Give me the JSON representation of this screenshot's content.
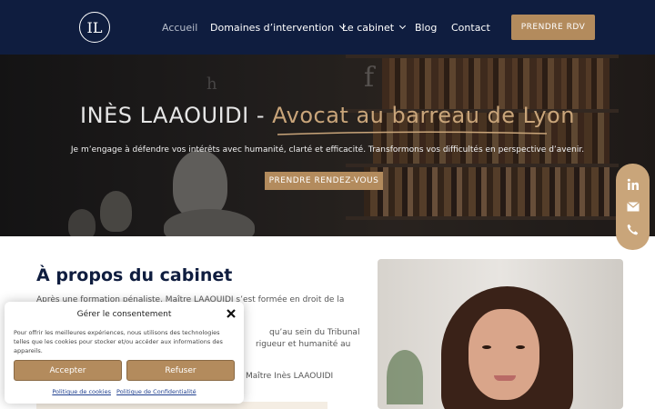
{
  "header": {
    "logo": "IL",
    "nav": {
      "home": "Accueil",
      "domaines": "Domaines d’intervention",
      "cabinet": "Le cabinet",
      "blog": "Blog",
      "contact": "Contact"
    },
    "cta": "PRENDRE RDV"
  },
  "hero": {
    "title_name": "INÈS LAAOUIDI - ",
    "title_accent": "Avocat au barreau de Lyon",
    "subtitle": "Je m’engage à défendre vos intérêts avec humanité, clarté et efficacité. Transformons vos difficultés en perspective d’avenir.",
    "cta": "PRENDRE RENDEZ-VOUS"
  },
  "social": {
    "icons": [
      "linkedin-icon",
      "mail-icon",
      "phone-icon"
    ]
  },
  "about": {
    "title": "À propos du cabinet",
    "p1": "Après une formation pénaliste, Maître LAAOUIDI s’est formée en droit de la",
    "p2": "qu’au sein du Tribunal",
    "p3": "rigueur et humanité au",
    "p4": "Maître Inès LAAOUIDI"
  },
  "cookie": {
    "title": "Gérer le consentement",
    "text": "Pour offrir les meilleures expériences, nous utilisons des technologies telles que les cookies pour stocker et/ou accéder aux informations des appareils.",
    "accept": "Accepter",
    "refuse": "Refuser",
    "link_cookies": "Politique de cookies",
    "link_privacy": "Politique de Confidentialité"
  },
  "colors": {
    "navy": "#0f1d3f",
    "gold": "#b38b5d",
    "gold_light": "#c9a57a"
  }
}
